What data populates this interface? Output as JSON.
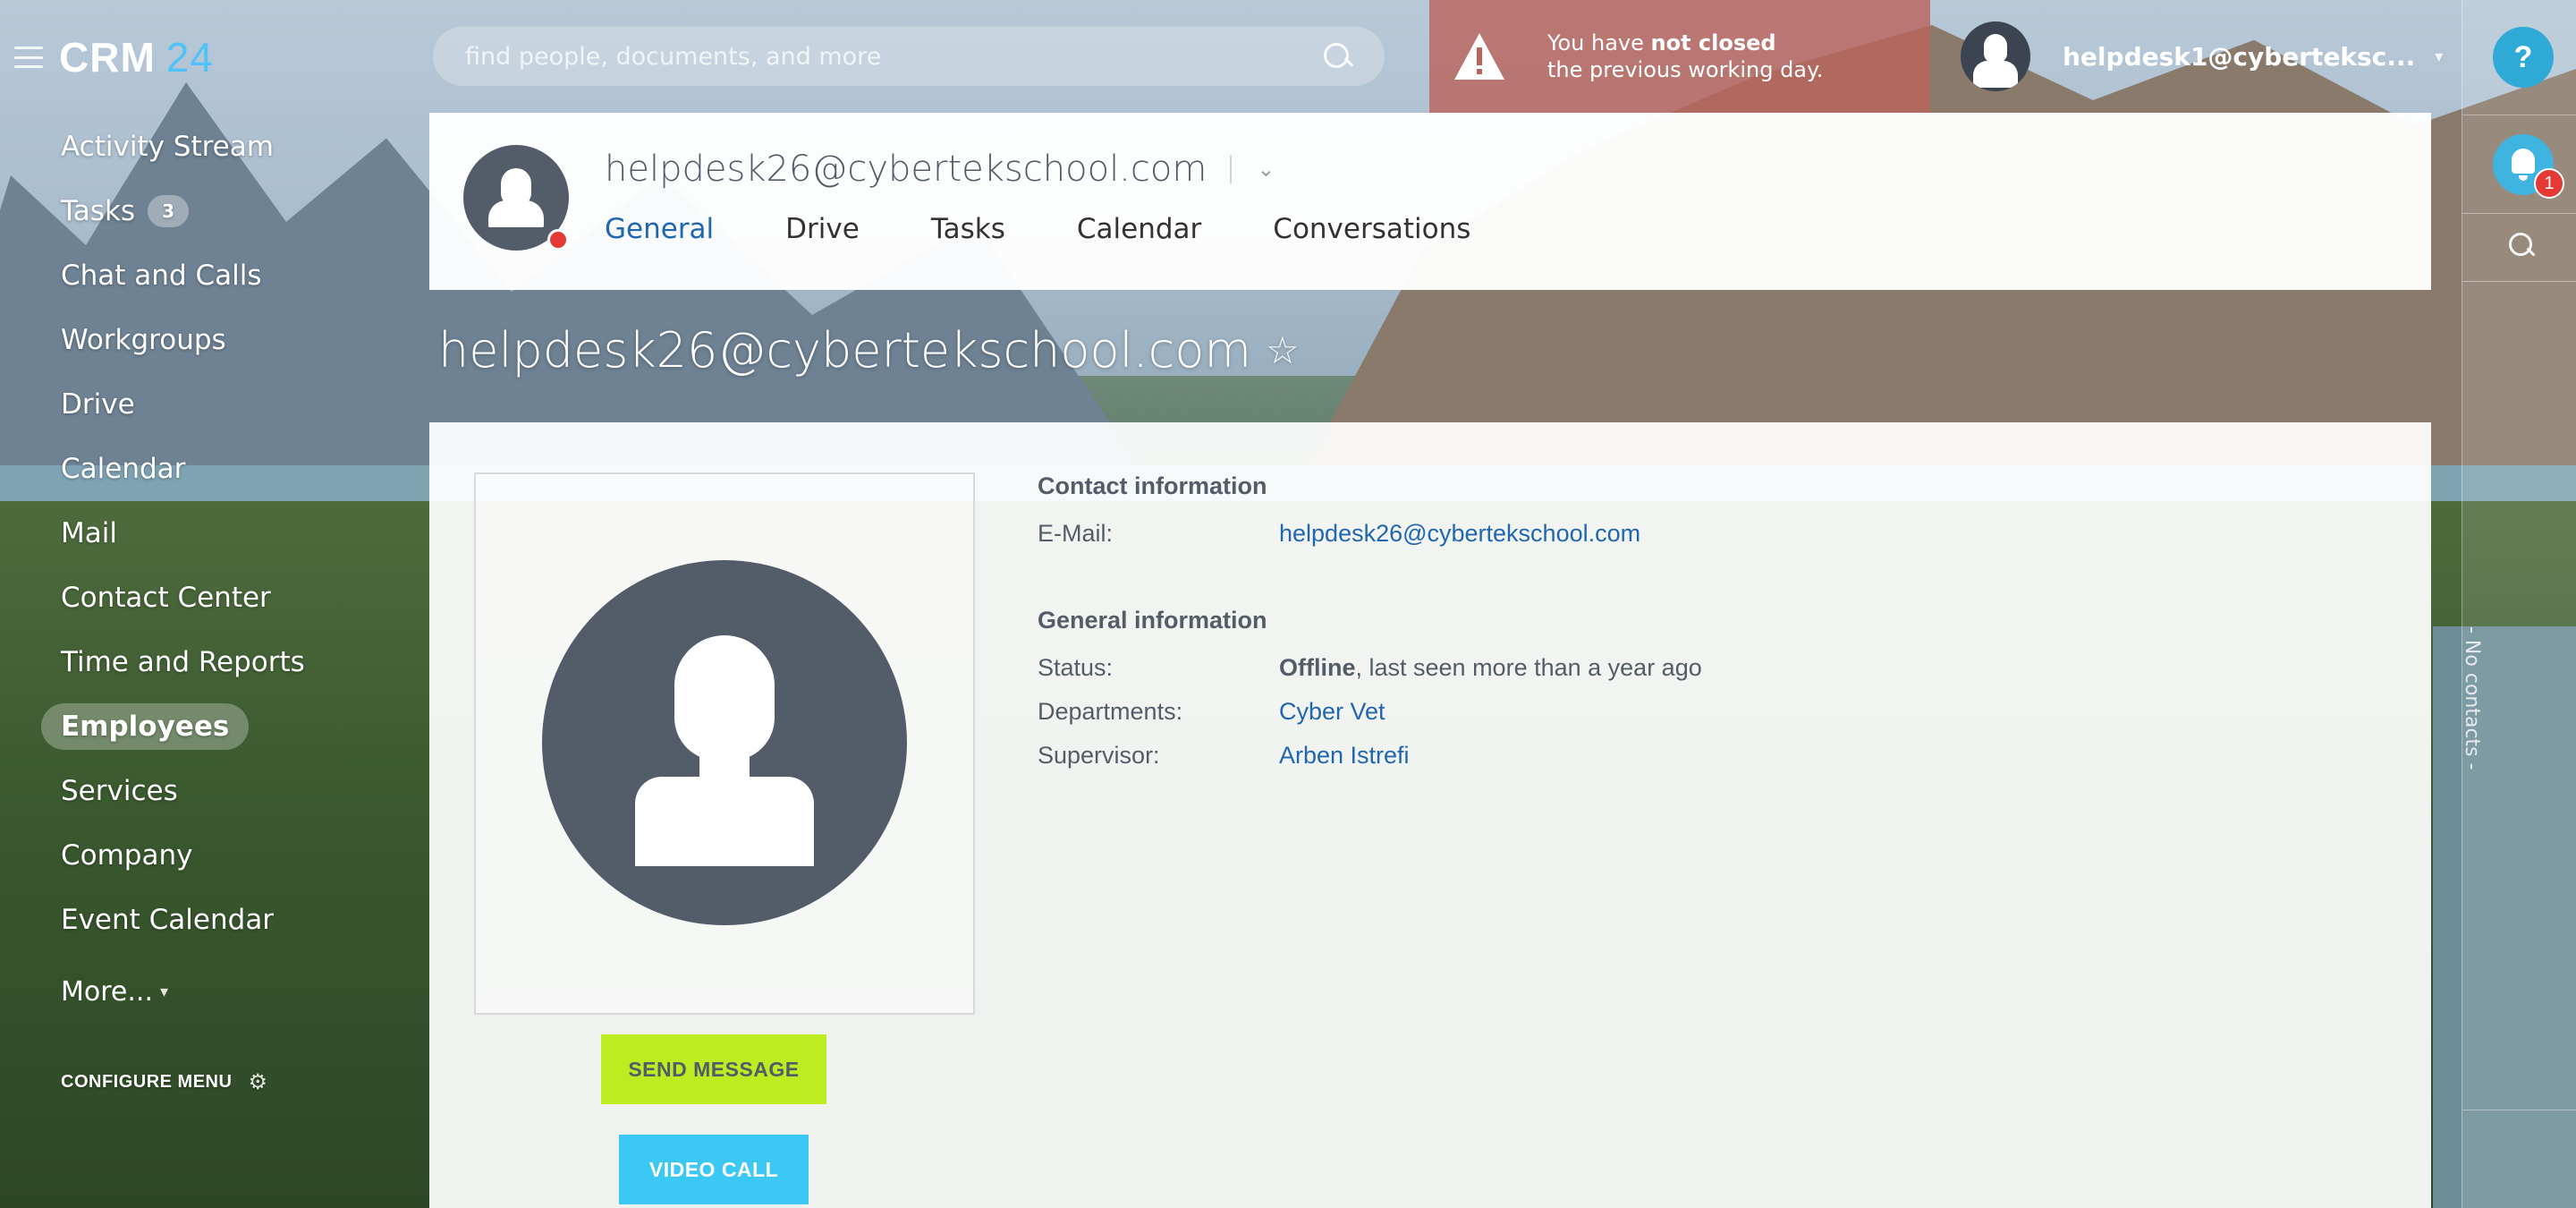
{
  "app": {
    "logo_main": "CRM",
    "logo_num": "24"
  },
  "search": {
    "placeholder": "find people, documents, and more"
  },
  "alert": {
    "line1_pre": "You have ",
    "line1_bold": "not closed",
    "line2": "the previous working day."
  },
  "user": {
    "name": "helpdesk1@cyberteksc..."
  },
  "right_panel": {
    "help": "?",
    "notifications_count": "1",
    "no_contacts": "- No contacts -"
  },
  "sidebar": {
    "items": [
      {
        "label": "Activity Stream"
      },
      {
        "label": "Tasks",
        "badge": "3"
      },
      {
        "label": "Chat and Calls"
      },
      {
        "label": "Workgroups"
      },
      {
        "label": "Drive"
      },
      {
        "label": "Calendar"
      },
      {
        "label": "Mail"
      },
      {
        "label": "Contact Center"
      },
      {
        "label": "Time and Reports"
      },
      {
        "label": "Employees",
        "active": true
      },
      {
        "label": "Services"
      },
      {
        "label": "Company"
      },
      {
        "label": "Event Calendar"
      }
    ],
    "more": "More...",
    "configure": "CONFIGURE MENU"
  },
  "profile_header": {
    "name": "helpdesk26@cybertekschool.com",
    "tabs": [
      {
        "label": "General",
        "active": true
      },
      {
        "label": "Drive"
      },
      {
        "label": "Tasks"
      },
      {
        "label": "Calendar"
      },
      {
        "label": "Conversations"
      }
    ]
  },
  "page": {
    "title": "helpdesk26@cybertekschool.com",
    "star": "☆"
  },
  "buttons": {
    "send_message": "SEND MESSAGE",
    "video_call": "VIDEO CALL"
  },
  "contact_info": {
    "heading": "Contact information",
    "email_label": "E-Mail:",
    "email_value": "helpdesk26@cybertekschool.com"
  },
  "general_info": {
    "heading": "General information",
    "status_label": "Status:",
    "status_bold": "Offline",
    "status_rest": ", last seen more than a year ago",
    "departments_label": "Departments:",
    "departments_value": "Cyber Vet",
    "supervisor_label": "Supervisor:",
    "supervisor_value": "Arben Istrefi"
  },
  "colors": {
    "accent_blue": "#2067b0",
    "send_green": "#bbed21",
    "video_blue": "#3bc8f5",
    "alert_red": "#b9645c",
    "offline_dot": "#e53935"
  }
}
